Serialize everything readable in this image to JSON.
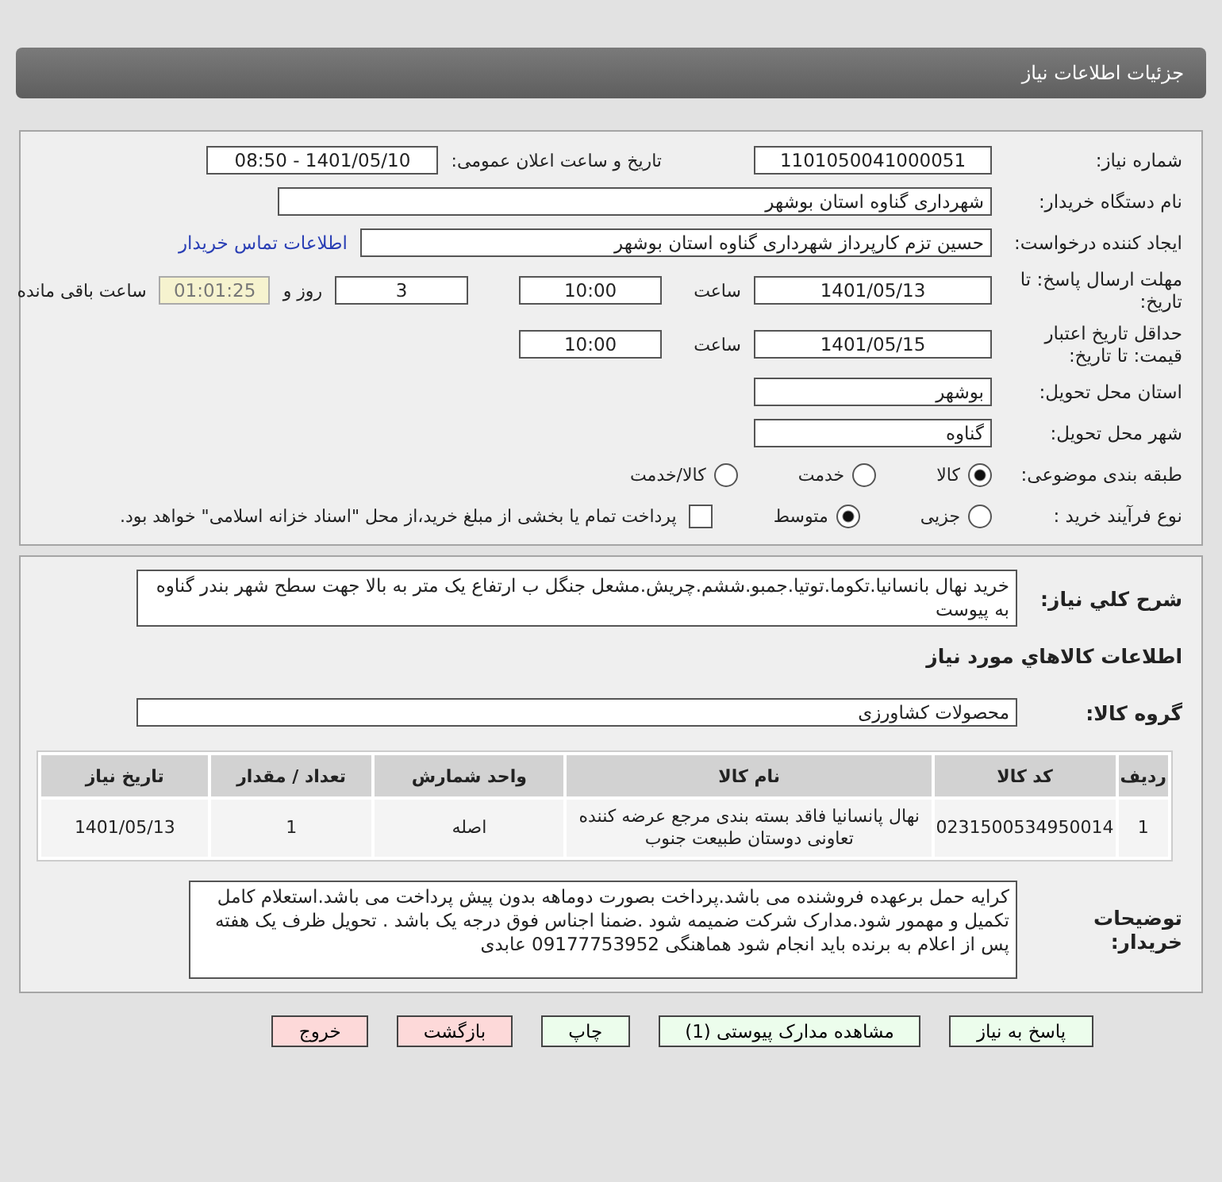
{
  "header": {
    "title": "جزئیات اطلاعات نیاز"
  },
  "need_number": {
    "label": "شماره نیاز:",
    "value": "1101050041000051"
  },
  "announce": {
    "label": "تاریخ و ساعت اعلان عمومی:",
    "value": "1401/05/10 - 08:50"
  },
  "buyer_org": {
    "label": "نام دستگاه خریدار:",
    "value": "شهرداری گناوه استان بوشهر"
  },
  "requester": {
    "label": "ایجاد کننده درخواست:",
    "value": "حسین تزم کارپرداز شهرداری گناوه استان بوشهر",
    "link": "اطلاعات تماس خریدار"
  },
  "deadline": {
    "label": "مهلت ارسال پاسخ: تا تاریخ:",
    "date": "1401/05/13",
    "time_label": "ساعت",
    "time": "10:00",
    "days": "3",
    "days_label": "روز و",
    "remaining": "01:01:25",
    "remaining_label": "ساعت باقی مانده"
  },
  "validity": {
    "label": "حداقل تاریخ اعتبار قیمت: تا تاریخ:",
    "date": "1401/05/15",
    "time_label": "ساعت",
    "time": "10:00"
  },
  "province": {
    "label": "استان محل تحویل:",
    "value": "بوشهر"
  },
  "city": {
    "label": "شهر محل تحویل:",
    "value": "گناوه"
  },
  "category": {
    "label": "طبقه بندی موضوعی:",
    "options": [
      {
        "label": "کالا",
        "selected": true
      },
      {
        "label": "خدمت",
        "selected": false
      },
      {
        "label": "کالا/خدمت",
        "selected": false
      }
    ]
  },
  "process": {
    "label": "نوع فرآیند خرید :",
    "options": [
      {
        "label": "جزیی",
        "selected": false
      },
      {
        "label": "متوسط",
        "selected": true
      }
    ],
    "treasury": {
      "checked": false,
      "label": "پرداخت تمام یا بخشی از مبلغ خرید،از محل \"اسناد خزانه اسلامی\" خواهد بود."
    }
  },
  "description": {
    "label": "شرح کلي نياز:",
    "value": "خرید نهال بانسانیا.تکوما.توتیا.جمبو.ششم.چریش.مشعل جنگل ب ارتفاع یک متر به بالا جهت سطح شهر بندر گناوه به پیوست"
  },
  "goods_title": "اطلاعات کالاهاي مورد نياز",
  "goods_group": {
    "label": "گروه کالا:",
    "value": "محصولات کشاورزی"
  },
  "table": {
    "columns": [
      "ردیف",
      "کد کالا",
      "نام کالا",
      "واحد شمارش",
      "تعداد / مقدار",
      "تاریخ نیاز"
    ],
    "rows": [
      [
        "1",
        "0231500534950014",
        "نهال پانسانیا فاقد بسته بندی مرجع عرضه کننده تعاونی دوستان طبیعت جنوب",
        "اصله",
        "1",
        "1401/05/13"
      ]
    ]
  },
  "buyer_notes": {
    "label": "توضیحات خریدار:",
    "value": "کرایه حمل برعهده فروشنده می باشد.پرداخت بصورت دوماهه بدون پیش پرداخت می باشد.استعلام کامل تکمیل و مهمور شود.مدارک شرکت ضمیمه شود .ضمنا اجناس فوق درجه یک باشد . تحویل ظرف یک هفته پس از اعلام به برنده باید انجام شود هماهنگی 09177753952 عابدی"
  },
  "buttons": [
    {
      "label": "پاسخ به نیاز",
      "kind": "normal"
    },
    {
      "label": "مشاهده مدارک پیوستی (1)",
      "kind": "normal"
    },
    {
      "label": "چاپ",
      "kind": "normal"
    },
    {
      "label": "بازگشت",
      "kind": "danger"
    },
    {
      "label": "خروج",
      "kind": "danger"
    }
  ]
}
